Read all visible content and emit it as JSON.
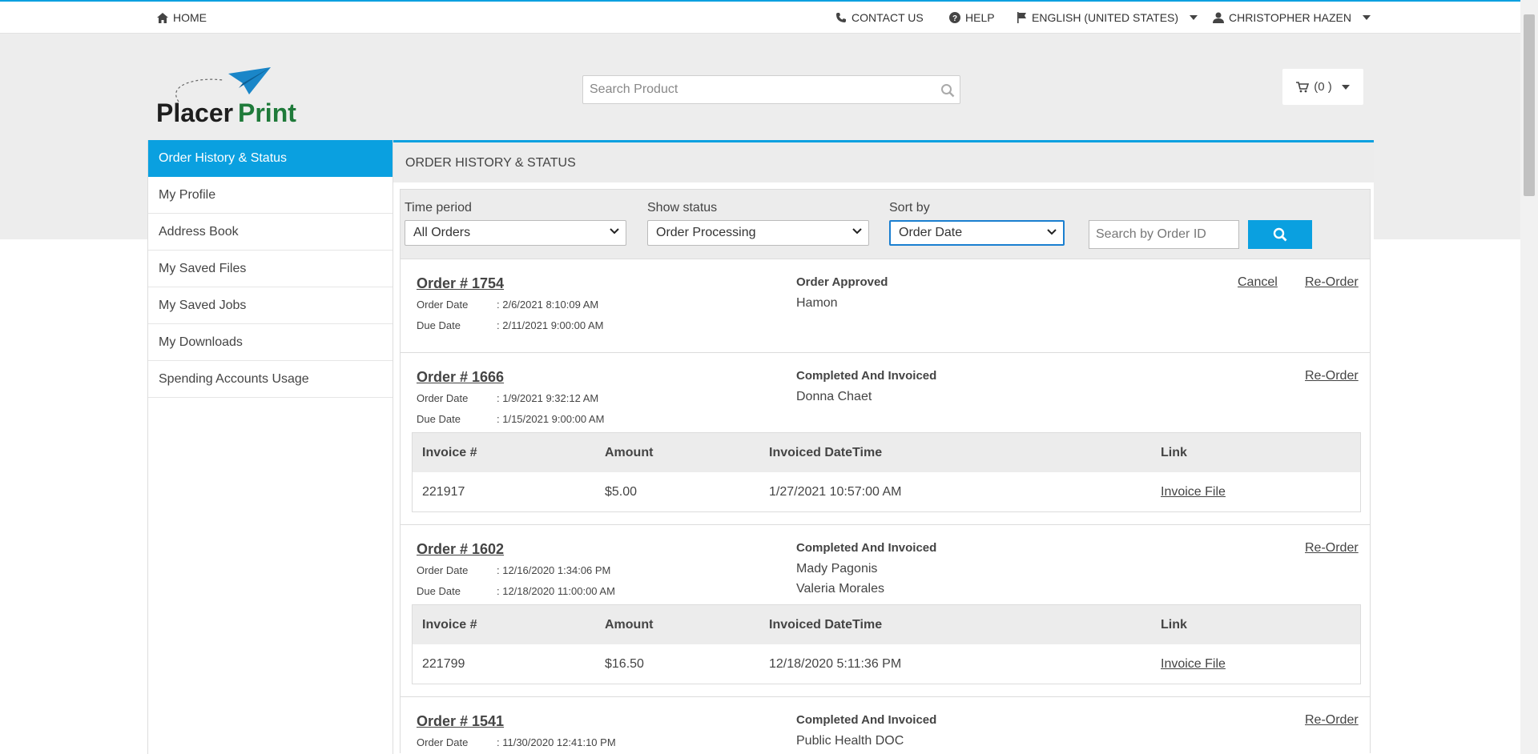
{
  "topbar": {
    "home": "HOME",
    "contact": "CONTACT US",
    "help": "HELP",
    "language": "ENGLISH (UNITED STATES)",
    "user": "CHRISTOPHER HAZEN"
  },
  "brand": {
    "logo_text_1": "Placer",
    "logo_text_2": "Print",
    "color_dark": "#1e1e1e",
    "color_green": "#1f7a3a",
    "color_plane": "#1a86c8"
  },
  "search": {
    "placeholder": "Search Product"
  },
  "cart": {
    "label": "(0 )"
  },
  "sidebar": {
    "items": [
      {
        "label": "Order History & Status",
        "active": true
      },
      {
        "label": "My Profile"
      },
      {
        "label": "Address Book"
      },
      {
        "label": "My Saved Files"
      },
      {
        "label": "My Saved Jobs"
      },
      {
        "label": "My Downloads"
      },
      {
        "label": "Spending Accounts Usage"
      }
    ]
  },
  "main": {
    "title": "ORDER HISTORY & STATUS"
  },
  "filters": {
    "time_period_label": "Time period",
    "time_period_value": "All Orders",
    "status_label": "Show status",
    "status_value": "Order Processing",
    "sort_label": "Sort by",
    "sort_value": "Order Date",
    "order_id_placeholder": "Search by Order ID"
  },
  "order_labels": {
    "order_date": "Order Date",
    "due_date": "Due Date",
    "cancel": "Cancel",
    "reorder": "Re-Order"
  },
  "invoice_headers": {
    "invoice": "Invoice #",
    "amount": "Amount",
    "datetime": "Invoiced DateTime",
    "link": "Link"
  },
  "orders": [
    {
      "number": "Order # 1754",
      "order_date": ": 2/6/2021 8:10:09 AM",
      "due_date": ": 2/11/2021 9:00:00 AM",
      "status": "Order Approved",
      "people": [
        "Hamon"
      ]
    },
    {
      "number": "Order # 1666",
      "order_date": ": 1/9/2021 9:32:12 AM",
      "due_date": ": 1/15/2021 9:00:00 AM",
      "status": "Completed And Invoiced",
      "people": [
        "Donna Chaet"
      ],
      "invoice": {
        "number": "221917",
        "amount": "$5.00",
        "datetime": "1/27/2021 10:57:00 AM",
        "link": "Invoice File"
      }
    },
    {
      "number": "Order # 1602",
      "order_date": ": 12/16/2020 1:34:06 PM",
      "due_date": ": 12/18/2020 11:00:00 AM",
      "status": "Completed And Invoiced",
      "people": [
        "Mady Pagonis",
        "Valeria Morales"
      ],
      "invoice": {
        "number": "221799",
        "amount": "$16.50",
        "datetime": "12/18/2020 5:11:36 PM",
        "link": "Invoice File"
      }
    },
    {
      "number": "Order # 1541",
      "order_date": ": 11/30/2020 12:41:10 PM",
      "status": "Completed And Invoiced",
      "people": [
        "Public Health DOC"
      ]
    }
  ]
}
